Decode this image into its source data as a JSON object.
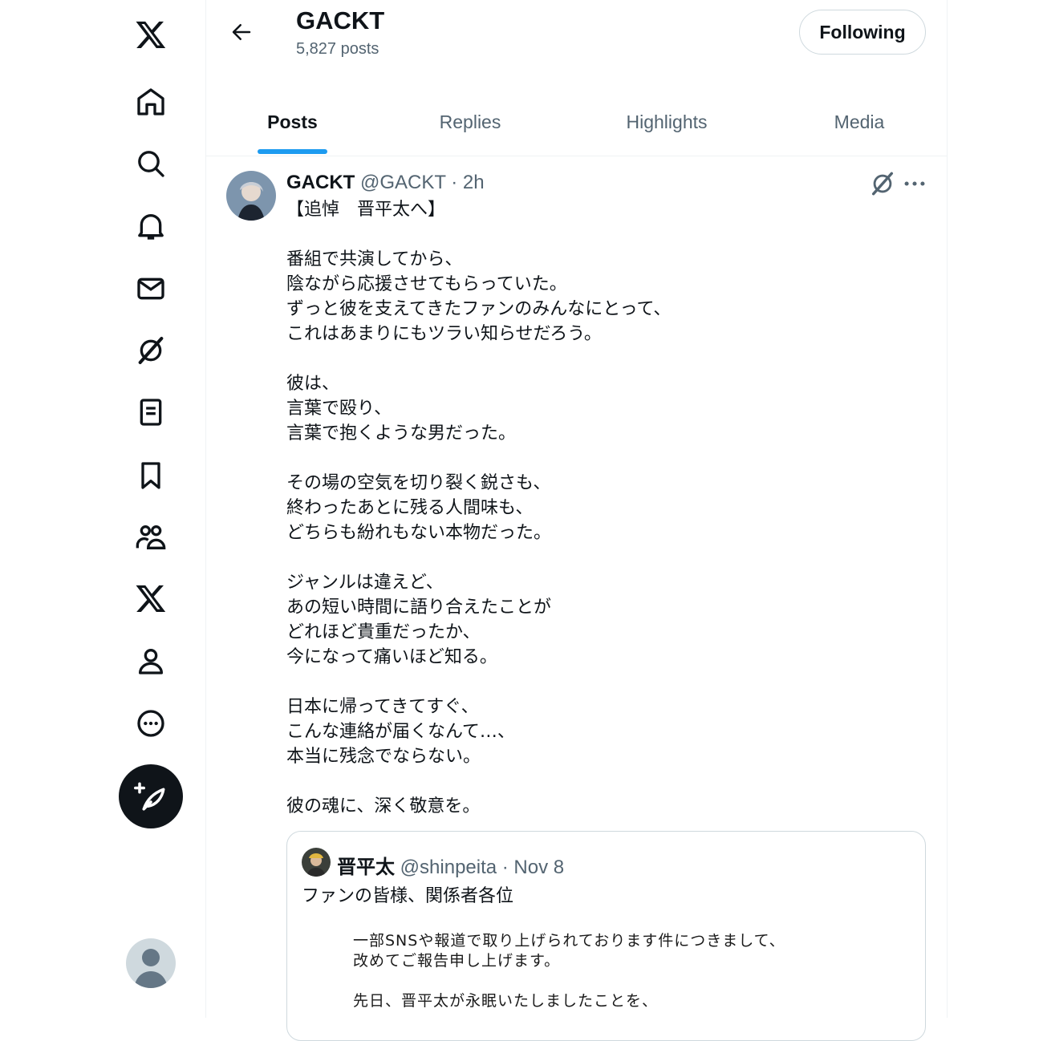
{
  "nav": {
    "items": [
      {
        "name": "x-logo-icon"
      },
      {
        "name": "home-icon"
      },
      {
        "name": "search-icon"
      },
      {
        "name": "bell-icon"
      },
      {
        "name": "mail-icon"
      },
      {
        "name": "grok-icon"
      },
      {
        "name": "list-icon"
      },
      {
        "name": "bookmark-icon"
      },
      {
        "name": "communities-icon"
      },
      {
        "name": "premium-x-icon"
      },
      {
        "name": "profile-icon"
      },
      {
        "name": "more-circle-icon"
      }
    ]
  },
  "header": {
    "name": "GACKT",
    "post_count": "5,827 posts",
    "follow_label": "Following"
  },
  "tabs": [
    {
      "label": "Posts",
      "active": true
    },
    {
      "label": "Replies",
      "active": false
    },
    {
      "label": "Highlights",
      "active": false
    },
    {
      "label": "Media",
      "active": false
    }
  ],
  "post": {
    "display_name": "GACKT",
    "meta": "@GACKT · 2h",
    "body": "【追悼　晋平太へ】\n\n番組で共演してから、\n陰ながら応援させてもらっていた。\nずっと彼を支えてきたファンのみんなにとって、\nこれはあまりにもツラい知らせだろう。\n\n彼は、\n言葉で殴り、\n言葉で抱くような男だった。\n\nその場の空気を切り裂く鋭さも、\n終わったあとに残る人間味も、\nどちらも紛れもない本物だった。\n\nジャンルは違えど、\nあの短い時間に語り合えたことが\nどれほど貴重だったか、\n今になって痛いほど知る。\n\n日本に帰ってきてすぐ、\nこんな連絡が届くなんて…、\n本当に残念でならない。\n\n彼の魂に、深く敬意を。"
  },
  "quote": {
    "display_name": "晋平太",
    "meta": "@shinpeita · Nov 8",
    "text": "ファンの皆様、関係者各位",
    "document": "一部SNSや報道で取り上げられております件につきまして、\n改めてご報告申し上げます。\n\n先日、晋平太が永眠いたしましたことを、"
  },
  "colors": {
    "accent": "#1d9bf0",
    "text": "#0f1419",
    "secondary": "#536471"
  }
}
